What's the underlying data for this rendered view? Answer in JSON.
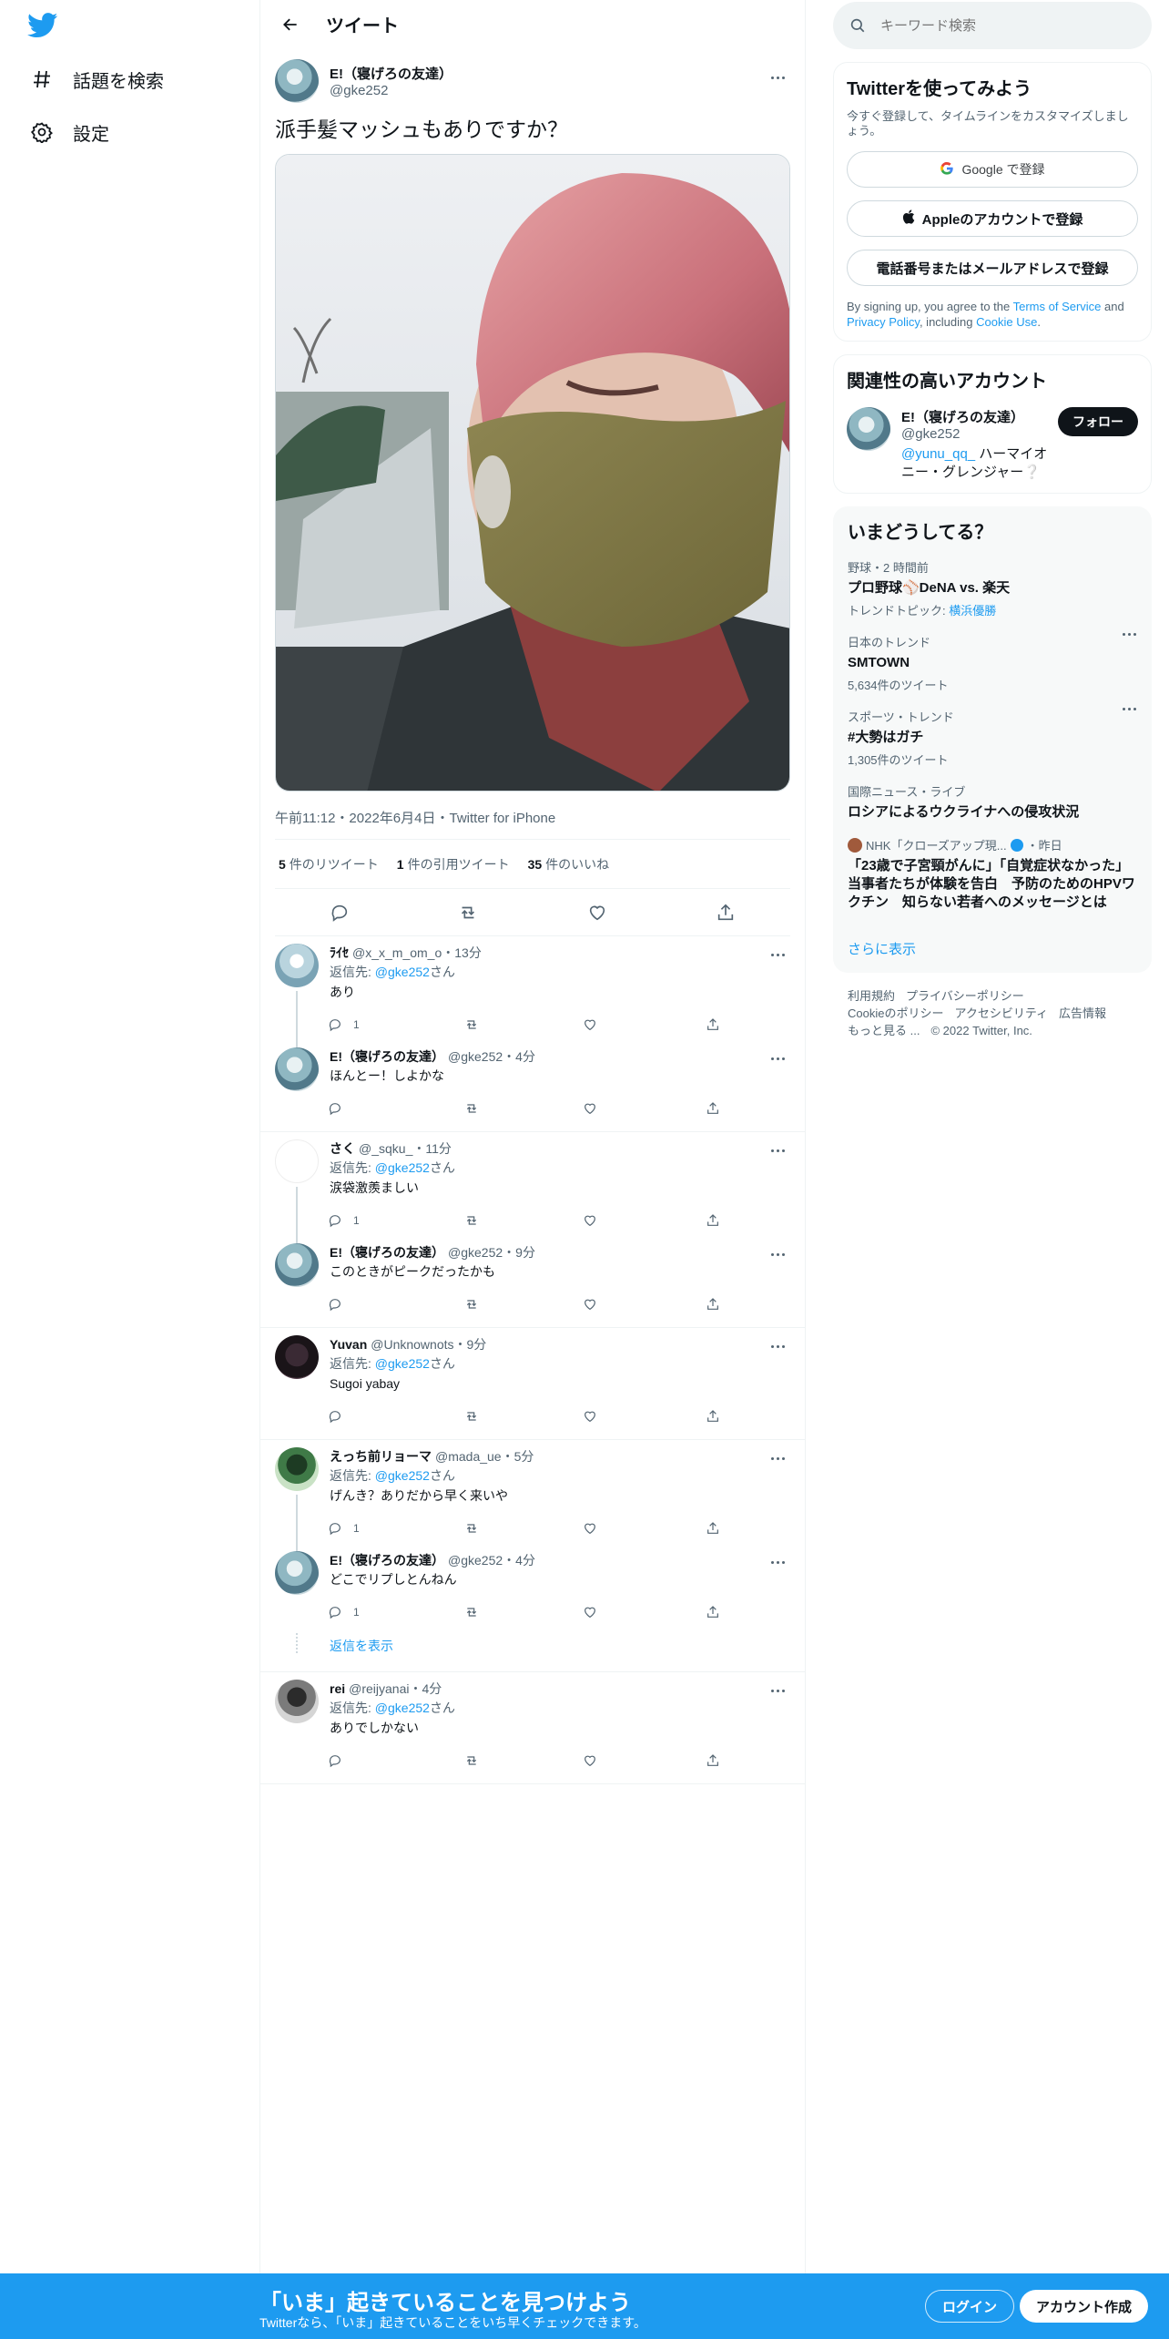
{
  "nav": {
    "items": [
      {
        "label": "話題を検索",
        "icon": "hashtag-icon"
      },
      {
        "label": "設定",
        "icon": "gear-icon"
      }
    ]
  },
  "header": {
    "title": "ツイート"
  },
  "tweet": {
    "name": "E!（寝げろの友達）",
    "handle": "@gke252",
    "text": "派手髪マッシュもありですか？",
    "meta": "午前11:12・2022年6月4日・Twitter for iPhone",
    "retweets_count": "5",
    "retweets_label": "件のリツイート",
    "quotes_count": "1",
    "quotes_label": "件の引用ツイート",
    "likes_count": "35",
    "likes_label": "件のいいね"
  },
  "replies": [
    {
      "name": "ﾗｲｾ",
      "handle": "@x_x_m_om_o",
      "time": "・13分",
      "to_prefix": "返信先: ",
      "to_handle": "@gke252",
      "to_suffix": "さん",
      "text": "あり",
      "reply_count": "1"
    },
    {
      "name": "E!（寝げろの友達）",
      "handle": "@gke252",
      "time": "・4分",
      "text": "ほんとー！しよかな",
      "reply_count": ""
    },
    {
      "name": "さく",
      "handle": "@_sqku_",
      "time": "・11分",
      "to_prefix": "返信先: ",
      "to_handle": "@gke252",
      "to_suffix": "さん",
      "text": "涙袋激羨ましい",
      "reply_count": "1"
    },
    {
      "name": "E!（寝げろの友達）",
      "handle": "@gke252",
      "time": "・9分",
      "text": "このときがピークだったかも",
      "reply_count": ""
    },
    {
      "name": "Yuvan",
      "handle": "@Unknownots",
      "time": "・9分",
      "to_prefix": "返信先: ",
      "to_handle": "@gke252",
      "to_suffix": "さん",
      "text": "Sugoi yabay",
      "reply_count": ""
    },
    {
      "name": "えっち前リョーマ",
      "handle": "@mada_ue",
      "time": "・5分",
      "to_prefix": "返信先: ",
      "to_handle": "@gke252",
      "to_suffix": "さん",
      "text": "げんき？ありだから早く来いや",
      "reply_count": "1"
    },
    {
      "name": "E!（寝げろの友達）",
      "handle": "@gke252",
      "time": "・4分",
      "text": "どこでリプしとんねん",
      "reply_count": "1"
    },
    {
      "name": "rei",
      "handle": "@reijyanai",
      "time": "・4分",
      "to_prefix": "返信先: ",
      "to_handle": "@gke252",
      "to_suffix": "さん",
      "text": "ありでしかない",
      "reply_count": ""
    }
  ],
  "show_replies": "返信を表示",
  "search": {
    "placeholder": "キーワード検索"
  },
  "signup": {
    "title": "Twitterを使ってみよう",
    "subtitle": "今すぐ登録して、タイムラインをカスタマイズしましょう。",
    "google": "Google で登録",
    "apple": "Appleのアカウントで登録",
    "phone": "電話番号またはメールアドレスで登録",
    "legal_1": "By signing up, you agree to the ",
    "tos": "Terms of Service",
    "legal_2": " and ",
    "privacy": "Privacy Policy",
    "legal_3": ", including ",
    "cookie": "Cookie Use",
    "legal_4": "."
  },
  "related": {
    "title": "関連性の高いアカウント",
    "name": "E!（寝げろの友達）",
    "handle": "@gke252",
    "follow": "フォロー",
    "desc_link": "@yunu_qq_",
    "desc_text": " ハーマイオニー・グレンジャー❔"
  },
  "trends": {
    "title": "いまどうしてる？",
    "items": [
      {
        "meta": "野球・2 時間前",
        "name": "プロ野球⚾DeNA vs. 楽天",
        "sub_prefix": "トレンドトピック: ",
        "sub_link": "横浜優勝"
      },
      {
        "meta": "日本のトレンド",
        "name": "SMTOWN",
        "sub": "5,634件のツイート"
      },
      {
        "meta": "スポーツ・トレンド",
        "name": "#大勢はガチ",
        "sub": "1,305件のツイート"
      },
      {
        "meta": "国際ニュース・ライブ",
        "name": "ロシアによるウクライナへの侵攻状況"
      }
    ],
    "news_source": "NHK「クローズアップ現...",
    "news_time": "・昨日",
    "news_text": "「23歳で子宮頸がんに」「自覚症状なかった」 当事者たちが体験を告白　予防のためのHPVワクチン　知らない若者へのメッセージとは",
    "show_more": "さらに表示"
  },
  "footer": {
    "links": [
      "利用規約",
      "プライバシーポリシー",
      "Cookieのポリシー",
      "アクセシビリティ",
      "広告情報",
      "もっと見る ...",
      "© 2022 Twitter, Inc."
    ]
  },
  "bottom": {
    "title": "「いま」起きていることを見つけよう",
    "subtitle": "Twitterなら、「いま」起きていることをいち早くチェックできます。",
    "login": "ログイン",
    "signup": "アカウント作成"
  },
  "colors": {
    "accent": "#1d9bf0",
    "text": "#0f1419",
    "muted": "#536471"
  }
}
